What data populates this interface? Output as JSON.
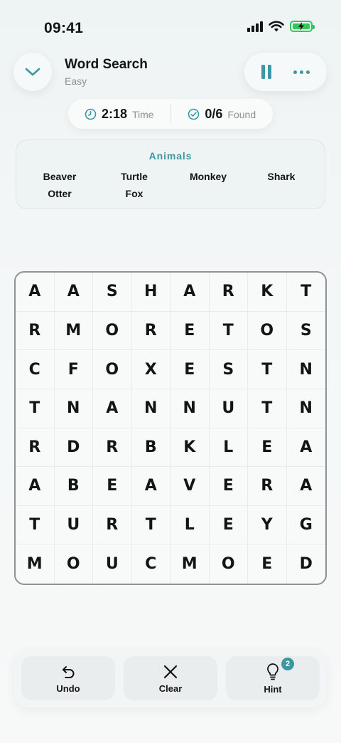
{
  "status_bar": {
    "time": "09:41"
  },
  "header": {
    "title": "Word Search",
    "subtitle": "Easy"
  },
  "info": {
    "time_value": "2:18",
    "time_label": "Time",
    "found_value": "0/6",
    "found_label": "Found"
  },
  "words_panel": {
    "category": "Animals",
    "words": [
      "Beaver",
      "Turtle",
      "Monkey",
      "Shark",
      "Otter",
      "Fox"
    ]
  },
  "grid": {
    "rows": [
      [
        "A",
        "A",
        "S",
        "H",
        "A",
        "R",
        "K",
        "T"
      ],
      [
        "R",
        "M",
        "O",
        "R",
        "E",
        "T",
        "O",
        "S"
      ],
      [
        "C",
        "F",
        "O",
        "X",
        "E",
        "S",
        "T",
        "N"
      ],
      [
        "T",
        "N",
        "A",
        "N",
        "N",
        "U",
        "T",
        "N"
      ],
      [
        "R",
        "D",
        "R",
        "B",
        "K",
        "L",
        "E",
        "A"
      ],
      [
        "A",
        "B",
        "E",
        "A",
        "V",
        "E",
        "R",
        "A"
      ],
      [
        "T",
        "U",
        "R",
        "T",
        "L",
        "E",
        "Y",
        "G"
      ],
      [
        "M",
        "O",
        "U",
        "C",
        "M",
        "O",
        "E",
        "D"
      ]
    ]
  },
  "toolbar": {
    "undo_label": "Undo",
    "clear_label": "Clear",
    "hint_label": "Hint",
    "hint_count": "2"
  },
  "colors": {
    "accent": "#3b98a0",
    "battery": "#34c759"
  },
  "icons": {
    "back": "chevron-down-icon",
    "pause": "pause-icon",
    "more": "more-dots-icon",
    "time": "clock-icon",
    "found": "check-circle-icon",
    "undo": "undo-icon",
    "clear": "close-icon",
    "hint": "lightbulb-icon"
  }
}
